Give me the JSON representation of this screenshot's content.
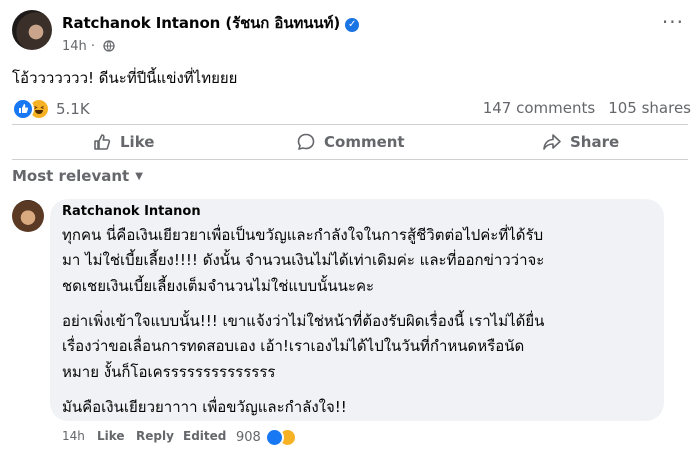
{
  "post": {
    "author": "Ratchanok Intanon (รัชนก อินทนนท์)",
    "time": "14h",
    "separator": "·",
    "text": "โอ้ววววววว! ดีนะที่ปีนี้แข่งที่ไทยยย",
    "more_label": "···"
  },
  "reactions": {
    "count": "5.1K"
  },
  "stats": {
    "comments": "147 comments",
    "shares": "105 shares"
  },
  "actions": {
    "like": "Like",
    "comment": "Comment",
    "share": "Share"
  },
  "filter": {
    "label": "Most relevant"
  },
  "comment": {
    "author": "Ratchanok Intanon",
    "paragraph1": [
      "ทุกคน นี่คือเงินเยียวยาเพื่อเป็นขวัญและกำลังใจในการสู้ชีวิตต่อไปค่ะที่ได้รับ",
      "มา ไม่ใช่เบี้ยเลี้ยง!!!! ดังนั้น จำนวนเงินไม่ได้เท่าเดิมค่ะ และที่ออกข่าวว่าจะ",
      "ชดเชยเงินเบี้ยเลี้ยงเต็มจำนวนไม่ใช่แบบนั้นนะคะ"
    ],
    "paragraph2": [
      "อย่าเพิ่งเข้าใจแบบนั้น!!! เขาแจ้งว่าไม่ใช่หน้าที่ต้องรับผิดเรื่องนี้ เราไม่ได้ยื่น",
      "เรื่องว่าขอเลื่อนการทดสอบเอง เอ้า!เราเองไม่ได้ไปในวันที่กำหนดหรือนัด",
      "หมาย งั้นก็โอเครรรรรรรรรรรรรร"
    ],
    "paragraph3": [
      "มันคือเงินเยียวยาาาา เพื่อขวัญและกำลังใจ!!"
    ],
    "time": "14h",
    "like": "Like",
    "reply": "Reply",
    "edited": "Edited",
    "reaction_count": "908"
  },
  "colors": {
    "verified": "#1b74e4",
    "like": "#1877f2",
    "haha": "#f7b125",
    "secondary_text": "#65676b",
    "bubble": "#f0f2f5"
  },
  "icons": [
    "verified-badge-icon",
    "globe-icon",
    "like-reaction-icon",
    "haha-reaction-icon",
    "thumbs-up-icon",
    "comment-bubble-icon",
    "share-arrow-icon",
    "caret-down-icon"
  ]
}
